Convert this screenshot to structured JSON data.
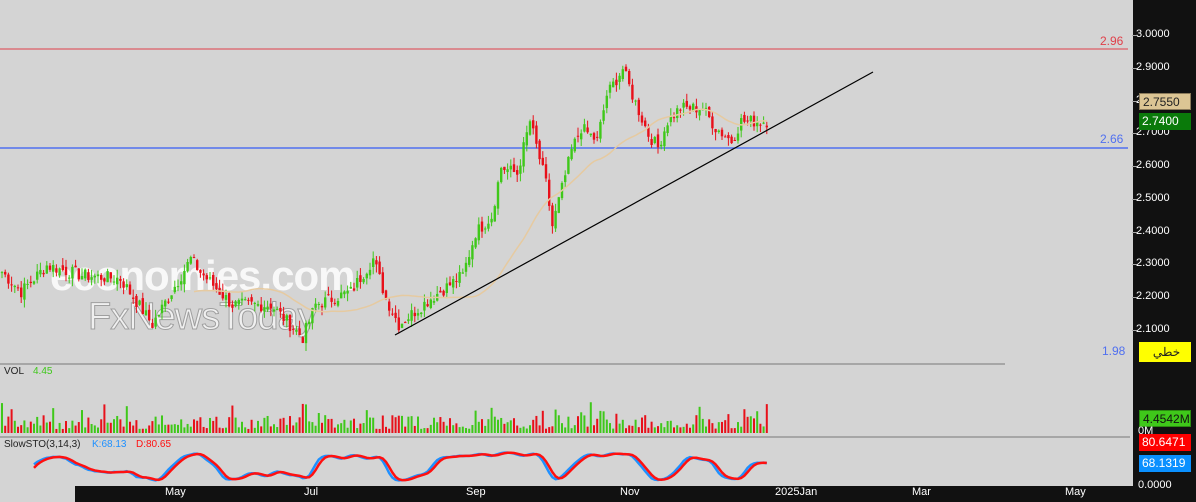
{
  "chart_data": {
    "type": "candlestick",
    "price_axis": {
      "ticks": [
        "3.0000",
        "2.9000",
        "2.8000",
        "2.7000",
        "2.6000",
        "2.5000",
        "2.4000",
        "2.3000",
        "2.2000",
        "2.1000"
      ],
      "ylim": [
        2.05,
        3.04
      ]
    },
    "x_ticks": [
      "May",
      "Jul",
      "Sep",
      "Nov",
      "2025Jan",
      "Mar",
      "May"
    ],
    "price_path": [
      [
        0,
        2.28
      ],
      [
        6,
        2.22
      ],
      [
        14,
        2.3
      ],
      [
        25,
        2.27
      ],
      [
        37,
        2.26
      ],
      [
        47,
        2.12
      ],
      [
        59,
        2.32
      ],
      [
        62,
        2.28
      ],
      [
        72,
        2.18
      ],
      [
        84,
        2.18
      ],
      [
        94,
        2.08
      ],
      [
        98,
        2.18
      ],
      [
        109,
        2.22
      ],
      [
        116,
        2.32
      ],
      [
        120,
        2.2
      ],
      [
        124,
        2.12
      ],
      [
        134,
        2.2
      ],
      [
        144,
        2.27
      ],
      [
        148,
        2.4
      ],
      [
        153,
        2.45
      ],
      [
        156,
        2.6
      ],
      [
        161,
        2.58
      ],
      [
        165,
        2.74
      ],
      [
        170,
        2.55
      ],
      [
        172,
        2.42
      ],
      [
        178,
        2.65
      ],
      [
        181,
        2.72
      ],
      [
        186,
        2.68
      ],
      [
        189,
        2.82
      ],
      [
        194,
        2.9
      ],
      [
        197,
        2.82
      ],
      [
        202,
        2.7
      ],
      [
        205,
        2.66
      ],
      [
        208,
        2.74
      ],
      [
        212,
        2.78
      ],
      [
        219,
        2.78
      ],
      [
        223,
        2.72
      ],
      [
        228,
        2.68
      ],
      [
        231,
        2.74
      ],
      [
        240,
        2.74
      ]
    ],
    "last_price": "2.7400",
    "prev_price": "2.7550",
    "hlines": [
      {
        "value": "2.96",
        "color": "#e0404a"
      },
      {
        "value": "2.66",
        "color": "#5070f0"
      },
      {
        "value": "1.98",
        "color": "#5070f0"
      }
    ],
    "trendline_label": "خطي",
    "volume": {
      "label": "VOL",
      "value": "4.45",
      "last": "4.4542M",
      "zero": "0M"
    },
    "stoch": {
      "label": "SlowSTO(3,14,3)",
      "k": "K:68.13",
      "d": "D:80.65",
      "k_last": "68.1319",
      "d_last": "80.6471",
      "zero": "0.0000"
    },
    "watermark": [
      "economies.com",
      "FxNewsToday"
    ]
  },
  "colors": {
    "up": "#3fc81a",
    "down": "#e8101a",
    "ma": "#e6caa0",
    "k": "#1e90ff",
    "d": "#ff1010"
  }
}
